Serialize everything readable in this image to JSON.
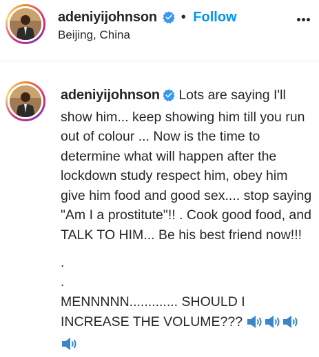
{
  "post_header": {
    "username": "adeniyijohnson",
    "separator": "•",
    "follow_label": "Follow",
    "location": "Beijing, China"
  },
  "comment": {
    "username": "adeniyijohnson",
    "text": "Lots are saying I'll show him... keep showing him till you run out of colour ... Now is the time to determine what will happen after the lockdown study respect him, obey him give him food and good sex.... stop saying \"Am I a prostitute\"!! . Cook good food, and TALK TO HIM... Be his best friend now!!!",
    "dot1": ".",
    "dot2": ".",
    "final_text": "MENNNNN............. SHOULD I INCREASE THE VOLUME???",
    "emoji": "speaker-high-volume-icon x4"
  },
  "colors": {
    "follow": "#0095f6",
    "verified": "#3897f0",
    "text": "#262626"
  }
}
